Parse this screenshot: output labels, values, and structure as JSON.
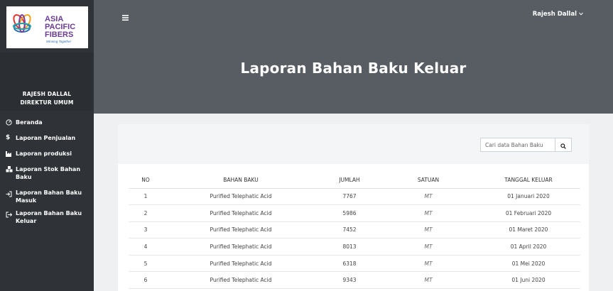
{
  "brand": {
    "logo_lines": [
      "ASIA",
      "PACIFIC",
      "FIBERS"
    ],
    "tagline": "Winning Together"
  },
  "user": {
    "name": "RAJESH DALLAL",
    "role": "DIREKTUR UMUM",
    "menu_label": "Rajesh Dallal"
  },
  "sidebar": {
    "items": [
      {
        "label": "Beranda",
        "icon": "dashboard-icon"
      },
      {
        "label": "Laporan Penjualan",
        "icon": "dollar-icon"
      },
      {
        "label": "Laporan produksi",
        "icon": "factory-icon"
      },
      {
        "label": "Laporan Stok Bahan Baku",
        "icon": "cubes-icon"
      },
      {
        "label": "Laporan Bahan Baku Masuk",
        "icon": "sign-in-icon"
      },
      {
        "label": "Laporan Bahan Baku Keluar",
        "icon": "sign-out-icon"
      }
    ]
  },
  "header": {
    "title": "Laporan Bahan Baku Keluar"
  },
  "search": {
    "placeholder": "Cari data Bahan Baku"
  },
  "table": {
    "columns": [
      "NO",
      "BAHAN BAKU",
      "JUMLAH",
      "SATUAN",
      "TANGGAL KELUAR"
    ],
    "rows": [
      [
        "1",
        "Purified Telephatic Acid",
        "7767",
        "MT",
        "01 Januari 2020"
      ],
      [
        "2",
        "Purified Telephatic Acid",
        "5986",
        "MT",
        "01 Februari 2020"
      ],
      [
        "3",
        "Purified Telephatic Acid",
        "7452",
        "MT",
        "01 Maret 2020"
      ],
      [
        "4",
        "Purified Telephatic Acid",
        "8013",
        "MT",
        "01 April 2020"
      ],
      [
        "5",
        "Purified Telephatic Acid",
        "6318",
        "MT",
        "01 Mei 2020"
      ],
      [
        "6",
        "Purified Telephatic Acid",
        "9343",
        "MT",
        "01 Juni 2020"
      ]
    ]
  },
  "colors": {
    "sidebar": "#2f3338",
    "header": "#585d63",
    "background": "#eef0f2"
  }
}
